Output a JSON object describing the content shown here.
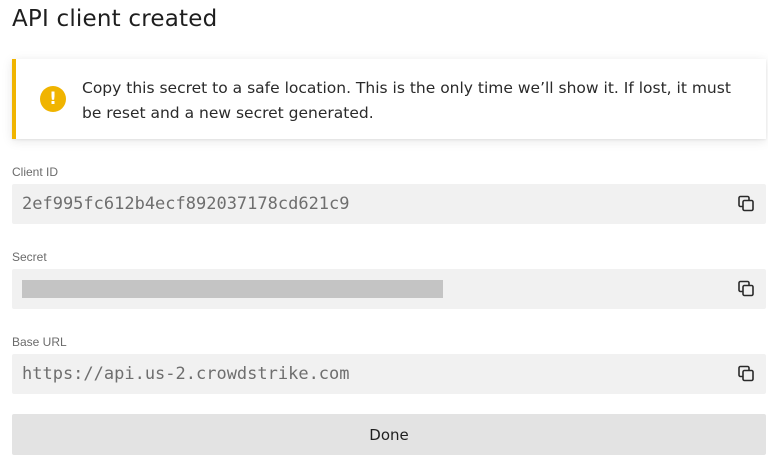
{
  "dialog": {
    "title": "API client created",
    "alert": {
      "icon": "warning-icon",
      "icon_glyph": "!",
      "message": "Copy this secret to a safe location. This is the only time we’ll show it. If lost, it must be reset and a new secret generated.",
      "accent_color": "#f0b400"
    },
    "fields": {
      "client_id": {
        "label": "Client ID",
        "value": "2ef995fc612b4ecf892037178cd621c9",
        "copy_icon": "copy-icon"
      },
      "secret": {
        "label": "Secret",
        "value_masked": true,
        "copy_icon": "copy-icon"
      },
      "base_url": {
        "label": "Base URL",
        "value": "https://api.us-2.crowdstrike.com",
        "copy_icon": "copy-icon"
      }
    },
    "done_label": "Done"
  }
}
